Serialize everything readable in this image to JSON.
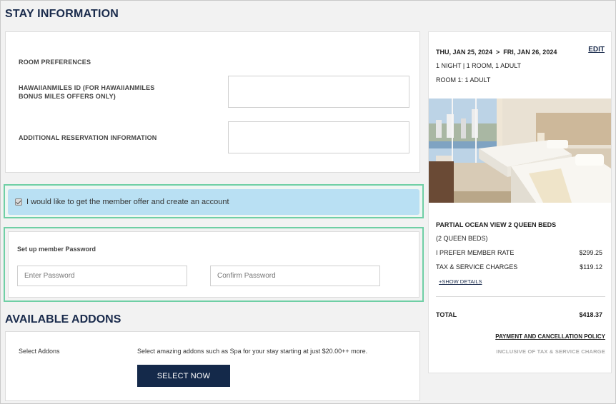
{
  "stay": {
    "title": "STAY INFORMATION",
    "room_preferences_label": "ROOM PREFERENCES",
    "hawaiianmiles_label": "HAWAIIANMILES ID (FOR HAWAIIANMILES BONUS MILES OFFERS ONLY)",
    "additional_info_label": "ADDITIONAL RESERVATION INFORMATION"
  },
  "offer": {
    "checkbox_label": "I would like to get the member offer and create an account",
    "checked": true
  },
  "password": {
    "label": "Set up member Password",
    "enter_placeholder": "Enter Password",
    "confirm_placeholder": "Confirm Password"
  },
  "addons": {
    "title": "AVAILABLE ADDONS",
    "select_label": "Select Addons",
    "description": "Select amazing addons such as Spa for your stay starting at just $20.00++ more.",
    "button_label": "SELECT NOW"
  },
  "summary": {
    "dates": "THU, JAN 25, 2024  >  FRI, JAN 26, 2024",
    "edit_label": "EDIT",
    "stay_line": "1 NIGHT | 1 ROOM, 1 ADULT",
    "room_line": "ROOM 1: 1 ADULT",
    "room_title": "PARTIAL OCEAN VIEW 2 QUEEN BEDS",
    "room_subtitle": "(2 QUEEN BEDS)",
    "rate_label": "I PREFER MEMBER RATE",
    "rate_value": "$299.25",
    "tax_label": "TAX & SERVICE CHARGES",
    "tax_value": "$119.12",
    "show_details": "+SHOW DETAILS",
    "total_label": "TOTAL",
    "total_value": "$418.37",
    "policy_link": "PAYMENT AND CANCELLATION POLICY",
    "inclusive_note": "INCLUSIVE OF TAX & SERVICE CHARGE"
  },
  "colors": {
    "navy": "#14294a",
    "highlight_border": "#6fcfa5",
    "offer_bg": "#b9e0f3"
  }
}
